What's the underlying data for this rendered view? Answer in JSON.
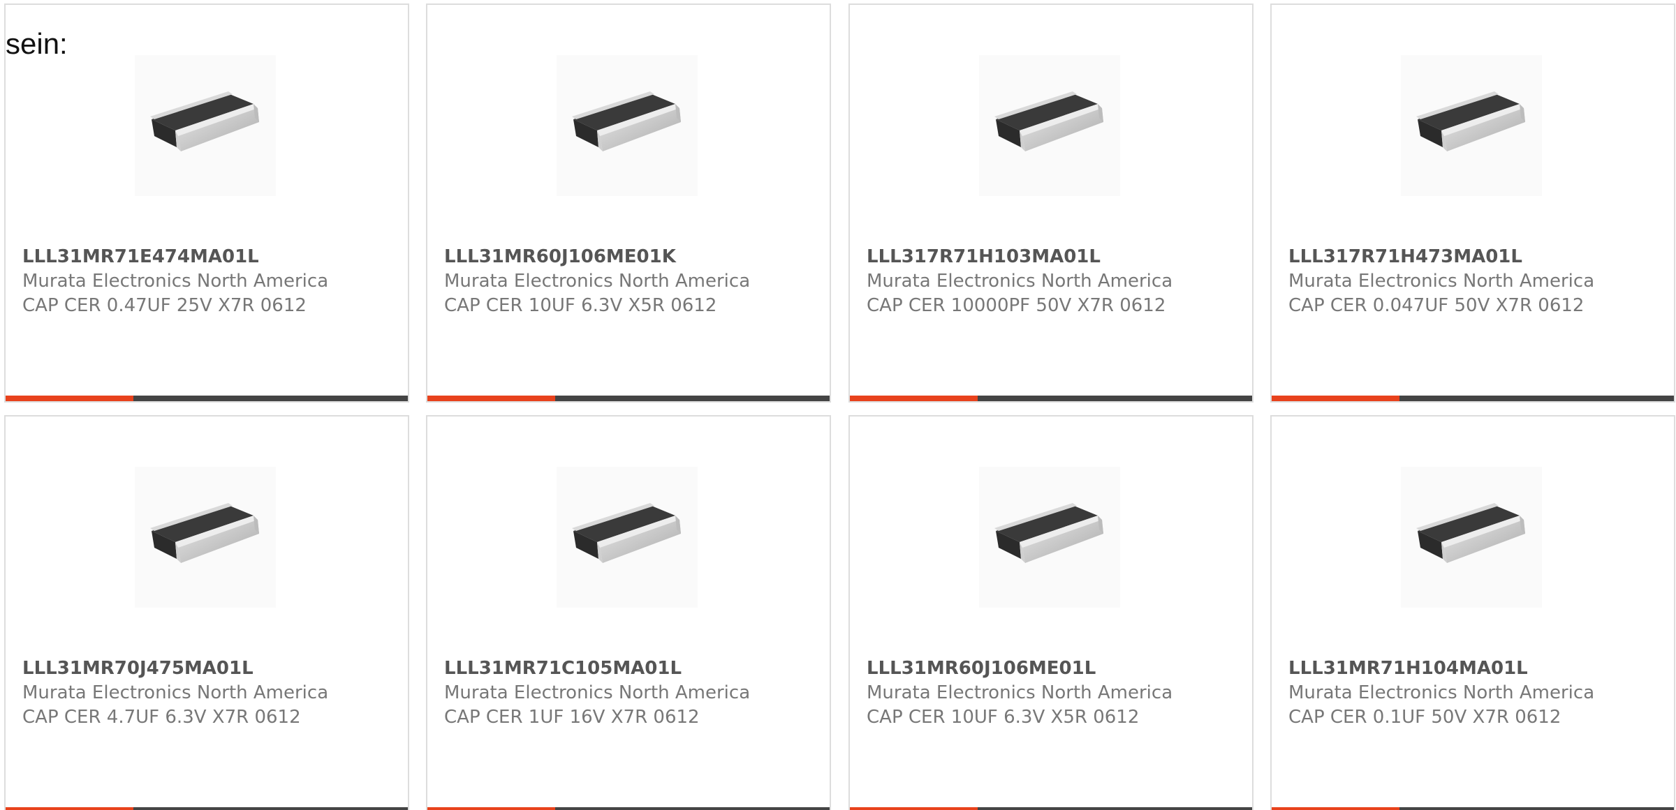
{
  "intro_text": "sein:",
  "colors": {
    "accent": "#e8421c",
    "bar": "#444444",
    "border": "#dddddd"
  },
  "products": [
    {
      "part_number": "LLL31MR71E474MA01L",
      "manufacturer": "Murata Electronics North America",
      "description": "CAP CER 0.47UF 25V X7R 0612",
      "image_icon": "capacitor-chip-image"
    },
    {
      "part_number": "LLL31MR60J106ME01K",
      "manufacturer": "Murata Electronics North America",
      "description": "CAP CER 10UF 6.3V X5R 0612",
      "image_icon": "capacitor-chip-image"
    },
    {
      "part_number": "LLL317R71H103MA01L",
      "manufacturer": "Murata Electronics North America",
      "description": "CAP CER 10000PF 50V X7R 0612",
      "image_icon": "capacitor-chip-image"
    },
    {
      "part_number": "LLL317R71H473MA01L",
      "manufacturer": "Murata Electronics North America",
      "description": "CAP CER 0.047UF 50V X7R 0612",
      "image_icon": "capacitor-chip-image"
    },
    {
      "part_number": "LLL31MR70J475MA01L",
      "manufacturer": "Murata Electronics North America",
      "description": "CAP CER 4.7UF 6.3V X7R 0612",
      "image_icon": "capacitor-chip-image"
    },
    {
      "part_number": "LLL31MR71C105MA01L",
      "manufacturer": "Murata Electronics North America",
      "description": "CAP CER 1UF 16V X7R 0612",
      "image_icon": "capacitor-chip-image"
    },
    {
      "part_number": "LLL31MR60J106ME01L",
      "manufacturer": "Murata Electronics North America",
      "description": "CAP CER 10UF 6.3V X5R 0612",
      "image_icon": "capacitor-chip-image"
    },
    {
      "part_number": "LLL31MR71H104MA01L",
      "manufacturer": "Murata Electronics North America",
      "description": "CAP CER 0.1UF 50V X7R 0612",
      "image_icon": "capacitor-chip-image"
    }
  ]
}
